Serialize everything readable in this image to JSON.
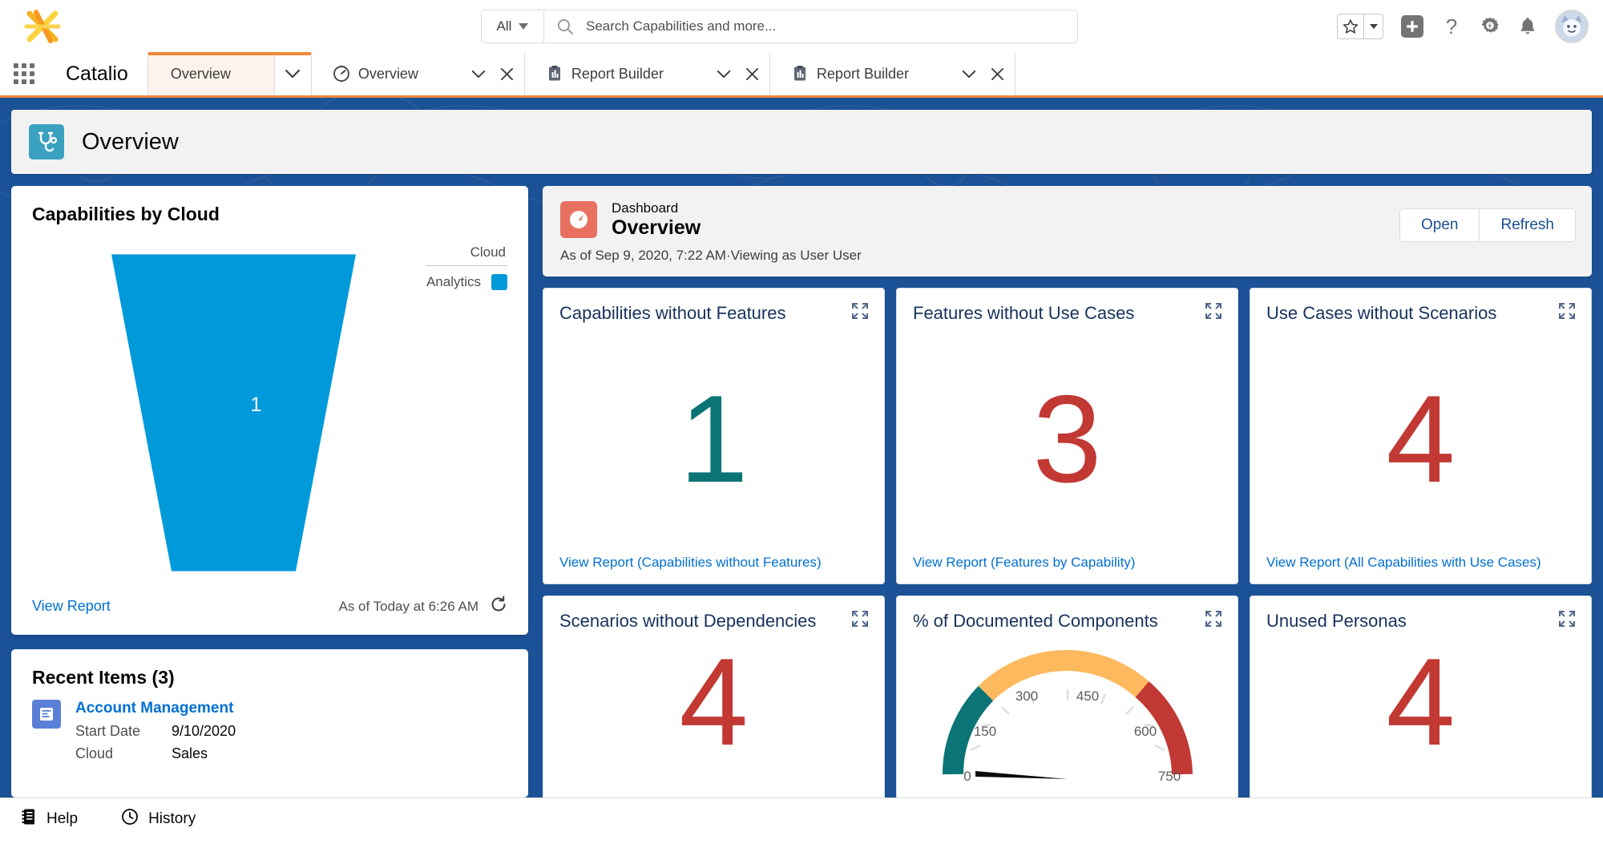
{
  "header": {
    "logo_icon": "app-logo-icon",
    "search": {
      "scope": "All",
      "placeholder": "Search Capabilities and more...",
      "icon": "search-icon"
    },
    "actions": {
      "favorites_icon": "star-icon",
      "favorites_caret_icon": "chevron-down-icon",
      "add_icon": "plus-icon",
      "help_icon": "question-mark-icon",
      "setup_icon": "gear-icon",
      "notifications_icon": "bell-icon",
      "avatar_icon": "user-avatar"
    }
  },
  "appnav": {
    "waffle_icon": "app-launcher-icon",
    "app_name": "Catalio",
    "tabs": [
      {
        "label": "Overview",
        "icon": "",
        "active": true,
        "closable": false,
        "chevron_icon": "chevron-down-icon"
      },
      {
        "label": "Overview",
        "icon": "dashboard-gauge-icon",
        "active": false,
        "closable": true,
        "chevron_icon": "chevron-down-icon",
        "close_icon": "close-icon"
      },
      {
        "label": "Report Builder",
        "icon": "report-icon",
        "active": false,
        "closable": true,
        "chevron_icon": "chevron-down-icon",
        "close_icon": "close-icon"
      },
      {
        "label": "Report Builder",
        "icon": "report-icon",
        "active": false,
        "closable": true,
        "chevron_icon": "chevron-down-icon",
        "close_icon": "close-icon"
      }
    ]
  },
  "page": {
    "icon": "stethoscope-icon",
    "icon_color": "#3aa2c0",
    "title": "Overview"
  },
  "funnel_card": {
    "title": "Capabilities by Cloud",
    "legend_title": "Cloud",
    "legend_label": "Analytics",
    "legend_color": "#009ada",
    "value_label": "1",
    "view_report": "View Report",
    "as_of": "As of Today at 6:26 AM",
    "refresh_icon": "refresh-icon"
  },
  "recent": {
    "title": "Recent Items (3)",
    "items": [
      {
        "icon": "record-icon",
        "name": "Account Management",
        "fields": [
          {
            "label": "Start Date",
            "value": "9/10/2020"
          },
          {
            "label": "Cloud",
            "value": "Sales"
          }
        ]
      }
    ]
  },
  "dashboard": {
    "icon": "dashboard-gauge-icon",
    "icon_color": "#e8705f",
    "kicker": "Dashboard",
    "name": "Overview",
    "subtitle": "As of Sep 9, 2020, 7:22 AM·Viewing as User User",
    "open_label": "Open",
    "refresh_label": "Refresh"
  },
  "widgets": [
    {
      "title": "Capabilities without Features",
      "value": "1",
      "value_color": "#0b7477",
      "link": "View Report (Capabilities without Features)",
      "expand_icon": "expand-icon"
    },
    {
      "title": "Features without Use Cases",
      "value": "3",
      "value_color": "#c23934",
      "link": "View Report (Features by Capability)",
      "expand_icon": "expand-icon"
    },
    {
      "title": "Use Cases without Scenarios",
      "value": "4",
      "value_color": "#c23934",
      "link": "View Report (All Capabilities with Use Cases)",
      "expand_icon": "expand-icon"
    },
    {
      "title": "Scenarios without Dependencies",
      "value": "4",
      "value_color": "#c23934",
      "link": "",
      "expand_icon": "expand-icon"
    },
    {
      "title": "% of Documented Components",
      "value": "",
      "value_color": "",
      "link": "",
      "expand_icon": "expand-icon"
    },
    {
      "title": "Unused Personas",
      "value": "4",
      "value_color": "#c23934",
      "link": "",
      "expand_icon": "expand-icon"
    }
  ],
  "chart_data": [
    {
      "type": "funnel",
      "title": "Capabilities by Cloud",
      "categories": [
        "Analytics"
      ],
      "values": [
        1
      ],
      "labels": [
        "1"
      ],
      "colors": [
        "#009ada"
      ],
      "legend": {
        "title": "Cloud",
        "entries": [
          "Analytics"
        ],
        "position": "top-right"
      }
    },
    {
      "type": "gauge",
      "title": "% of Documented Components",
      "ticks": [
        0,
        150,
        300,
        450,
        600,
        750
      ],
      "min": 0,
      "max": 750,
      "value": 0,
      "segments": [
        {
          "from": 0,
          "to": 230,
          "color": "#0b7477"
        },
        {
          "from": 230,
          "to": 520,
          "color": "#fdb95d"
        },
        {
          "from": 520,
          "to": 750,
          "color": "#c23934"
        }
      ]
    }
  ],
  "utility": {
    "items": [
      {
        "label": "Help",
        "icon": "help-book-icon"
      },
      {
        "label": "History",
        "icon": "clock-icon"
      }
    ]
  }
}
